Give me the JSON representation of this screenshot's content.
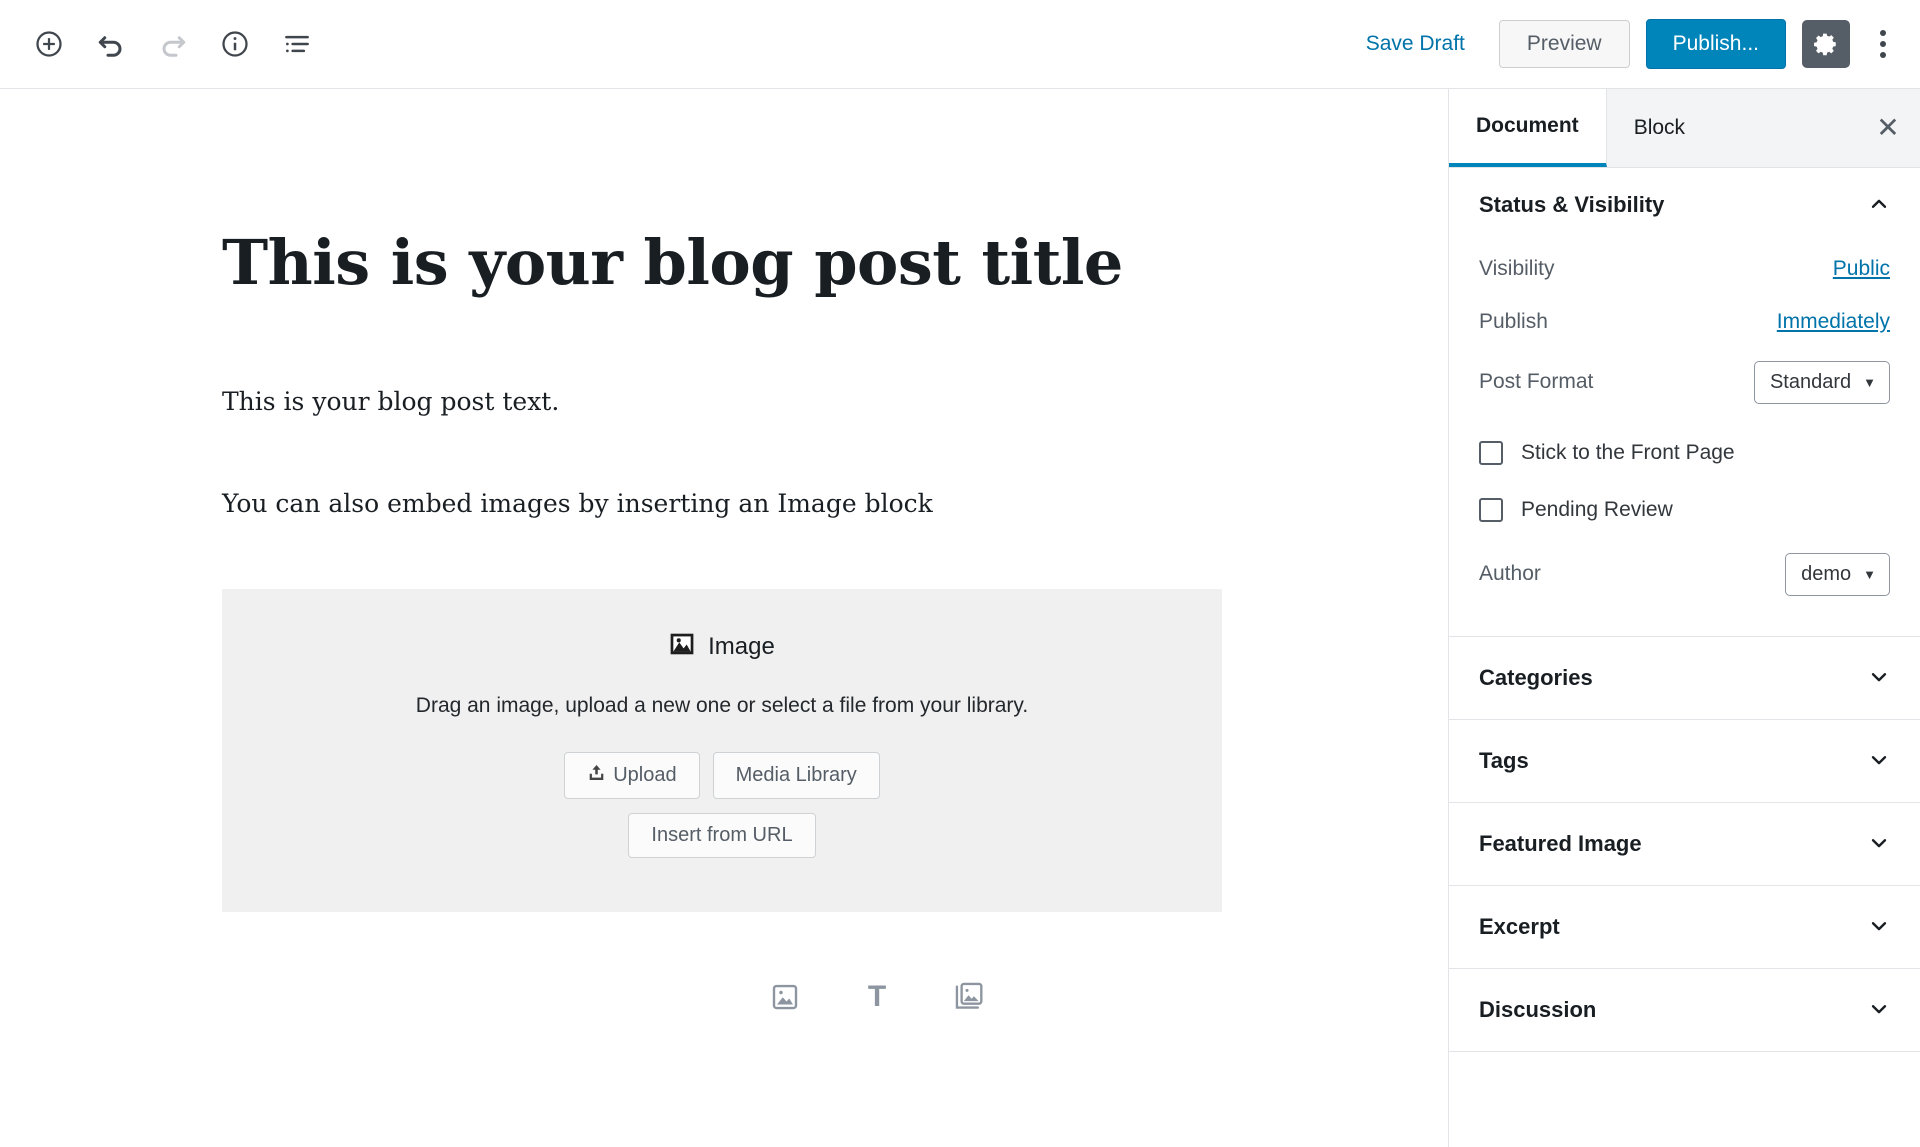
{
  "toolbar": {
    "icons": [
      {
        "name": "add-block-icon",
        "label": "Add block"
      },
      {
        "name": "undo-icon",
        "label": "Undo"
      },
      {
        "name": "redo-icon",
        "label": "Redo",
        "disabled": true
      },
      {
        "name": "content-info-icon",
        "label": "Content structure"
      },
      {
        "name": "block-navigation-icon",
        "label": "Block navigation"
      }
    ],
    "save_draft_label": "Save Draft",
    "preview_label": "Preview",
    "publish_label": "Publish...",
    "settings_icon": "gear-icon",
    "more_menu_icon": "ellipsis-vertical-icon",
    "publish_color": "#0085ba",
    "link_color": "#0073aa"
  },
  "editor": {
    "title": "This is your blog post title",
    "paragraphs": [
      "This is your blog post text.",
      "You can also embed images by inserting an Image block"
    ],
    "image_block": {
      "icon": "image-filled-icon",
      "label": "Image",
      "instructions": "Drag an image, upload a new one or select a file from your library.",
      "upload_label": "Upload",
      "upload_icon": "upload-icon",
      "media_library_label": "Media Library",
      "insert_url_label": "Insert from URL",
      "background": "#f0f0f0"
    },
    "block_suggestions": [
      {
        "name": "image-outline-icon",
        "label": "Image"
      },
      {
        "name": "text-paragraph-icon",
        "label": "Paragraph"
      },
      {
        "name": "gallery-icon",
        "label": "Gallery"
      }
    ]
  },
  "sidebar": {
    "tabs": [
      {
        "label": "Document",
        "active": true
      },
      {
        "label": "Block",
        "active": false
      }
    ],
    "close_icon": "close-icon",
    "close_glyph": "✕",
    "active_tab_indicator_color": "#0085ba",
    "status_panel": {
      "title": "Status & Visibility",
      "expanded": true,
      "chevron": "chevron-up-icon",
      "visibility_label": "Visibility",
      "visibility_value": "Public",
      "publish_label": "Publish",
      "publish_value": "Immediately",
      "post_format_label": "Post Format",
      "post_format_value": "Standard",
      "sticky_label": "Stick to the Front Page",
      "sticky_checked": false,
      "pending_label": "Pending Review",
      "pending_checked": false,
      "author_label": "Author",
      "author_value": "demo",
      "caret_glyph": "▼"
    },
    "panels": [
      {
        "title": "Categories",
        "expanded": false,
        "chevron": "chevron-down-icon"
      },
      {
        "title": "Tags",
        "expanded": false,
        "chevron": "chevron-down-icon"
      },
      {
        "title": "Featured Image",
        "expanded": false,
        "chevron": "chevron-down-icon"
      },
      {
        "title": "Excerpt",
        "expanded": false,
        "chevron": "chevron-down-icon"
      },
      {
        "title": "Discussion",
        "expanded": false,
        "chevron": "chevron-down-icon"
      }
    ]
  }
}
